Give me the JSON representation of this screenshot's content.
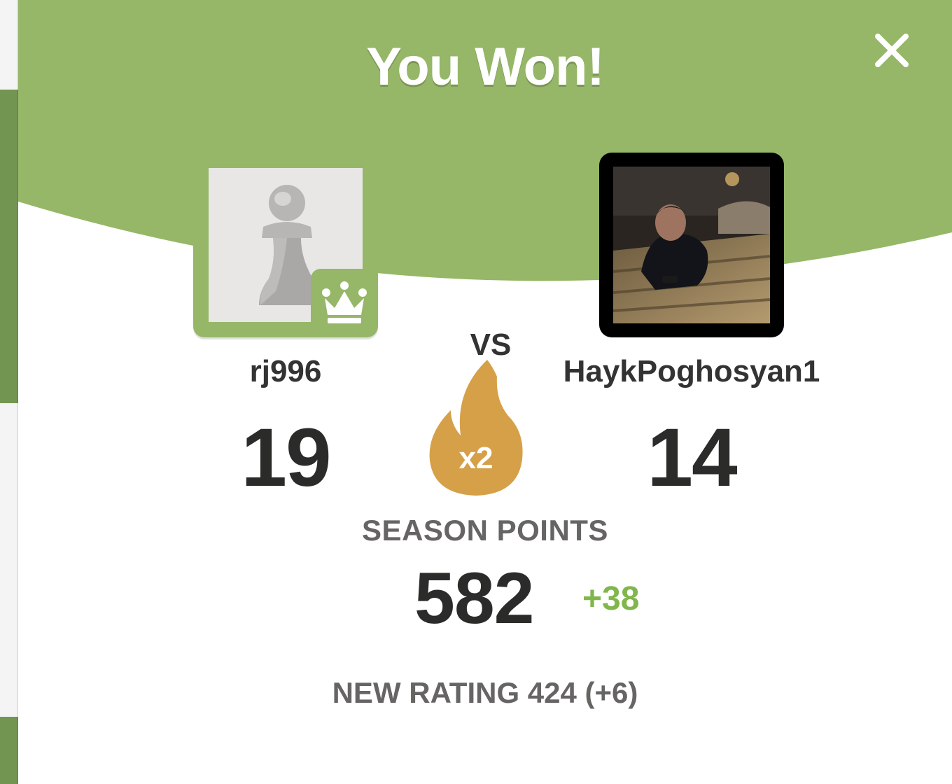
{
  "header": {
    "title": "You Won!",
    "close_icon": "close-icon",
    "background_color": "#95b767"
  },
  "players": {
    "me": {
      "username": "rj996",
      "score": "19",
      "avatar_icon": "pawn-icon",
      "badge_icon": "crown-icon"
    },
    "opponent": {
      "username": "HaykPoghosyan1",
      "score": "14",
      "avatar": "profile-photo"
    }
  },
  "versus_label": "VS",
  "multiplier": {
    "label": "x2",
    "icon": "flame-icon",
    "color": "#d5a047"
  },
  "season": {
    "label": "SEASON POINTS",
    "points": "582",
    "delta": "+38",
    "delta_color": "#81b64c"
  },
  "rating": {
    "text": "NEW RATING 424 (+6)"
  }
}
